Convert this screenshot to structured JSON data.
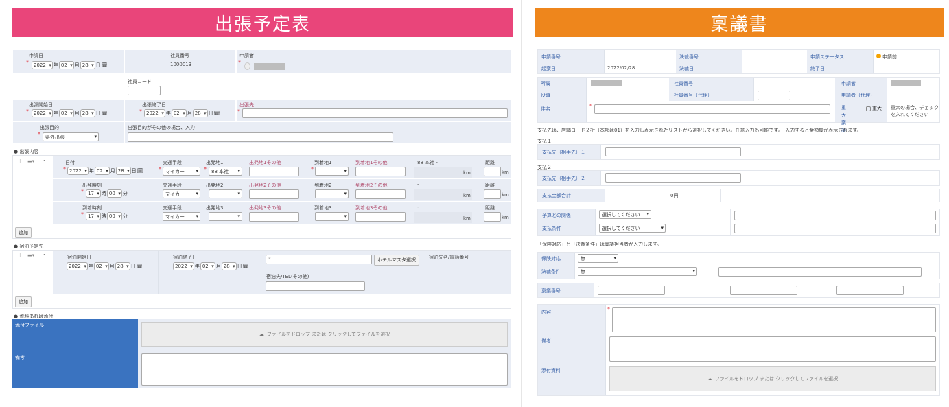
{
  "left": {
    "title": "出張予定表",
    "title_color": "#e9457a",
    "apply_date_label": "申請日",
    "employee_no_label": "社員番号",
    "employee_no": "1000013",
    "applicant_label": "申請者",
    "employee_code_label": "社員コード",
    "start_label": "出張開始日",
    "end_label": "出張終了日",
    "dest_label": "出張先",
    "purpose_label": "出張目的",
    "purpose_value": "県外出張",
    "purpose_other_label": "出張目的がその他の場合、入力",
    "date": {
      "year": "2022",
      "y": "年",
      "month": "02",
      "m": "月",
      "day": "28",
      "d": "日"
    },
    "trip_section": "● 出張内容",
    "row_no": "1",
    "date_label": "日付",
    "depart_time_label": "出発時刻",
    "arrive_time_label": "到着時刻",
    "hour": "17",
    "h": "時",
    "minute": "00",
    "mi": "分",
    "transport_label": "交通手段",
    "transport_value": "マイカー",
    "legs": [
      {
        "from": "出発地1",
        "from_val": "88 本社",
        "from_other": "出発地1その他",
        "to": "到着地1",
        "to_other": "到着地1その他",
        "route": "88 本社 -"
      },
      {
        "from": "出発地2",
        "from_val": "",
        "from_other": "出発地2その他",
        "to": "到着地2",
        "to_other": "到着地2その他",
        "route": "-"
      },
      {
        "from": "出発地3",
        "from_val": "",
        "from_other": "出発地3その他",
        "to": "到着地3",
        "to_other": "到着地3その他",
        "route": "-"
      }
    ],
    "km": "km",
    "distance_label": "距離",
    "add_label": "追加",
    "hotel_section": "● 宿泊予定先",
    "stay_start_label": "宿泊開始日",
    "stay_end_label": "宿泊終了日",
    "hotel_master_btn": "ホテルマスタ選択",
    "hotel_name_label": "宿泊先名/電話番号",
    "hotel_other_label": "宿泊先/TEL(その他)",
    "attach_section": "● 資料あれば添付",
    "attach_label": "添付ファイル",
    "dropzone": "ファイルをドロップ または クリックしてファイルを選択",
    "notes_label": "備考"
  },
  "right": {
    "title": "稟議書",
    "title_color": "#ee861c",
    "top": [
      {
        "l1": "申請番号",
        "v1": "",
        "l2": "決裁番号",
        "v2": "",
        "l3": "申請ステータス",
        "v3": "申請前"
      },
      {
        "l1": "起案日",
        "v1": "2022/02/28",
        "l2": "決裁日",
        "v2": "",
        "l3": "終了日",
        "v3": ""
      }
    ],
    "dept_label": "所属",
    "emp_no_label": "社員番号",
    "applicant_label": "申請者",
    "position_label": "役職",
    "emp_no_proxy_label": "社員番号（代理）",
    "applicant_proxy_label": "申請者（代理）",
    "subject_label": "件名",
    "urgent_label": "重大案議",
    "urgent_check": "重大",
    "urgent_note": "重大の場合、チェックを入れてください",
    "pay_note": "支払先は、店舗コード２桁（本部は01）を入力し表示されたリストから選択してください。任意入力も可能です。　入力すると金額欄が表示されます。",
    "pay1_heading": "支払１",
    "pay1_label": "支払先（相手先）１",
    "pay2_heading": "支払２",
    "pay2_label": "支払先（相手先）２",
    "total_label": "支払金額合計",
    "total_value": "0円",
    "budget_label": "予算との関係",
    "budget_value": "選択してください",
    "terms_label": "支払条件",
    "terms_value": "選択してください",
    "staff_note": "「保険対応」と「決裁条件」は稟議担当者が入力します。",
    "insurance_label": "保険対応",
    "insurance_value": "無",
    "condition_label": "決裁条件",
    "condition_value": "無",
    "ringi_no_label": "稟議番号",
    "content_label": "内容",
    "notes_label": "備考",
    "attach_label": "添付資料",
    "dropzone": "ファイルをドロップ または クリックしてファイルを選択",
    "status_color": "#f5a300"
  }
}
